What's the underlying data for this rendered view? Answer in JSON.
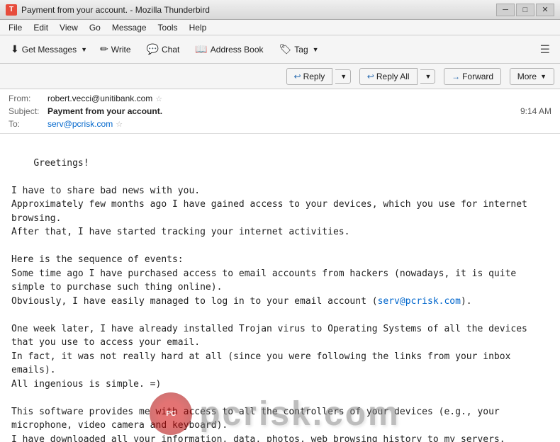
{
  "titlebar": {
    "icon_label": "T",
    "title": "Payment from your account. - Mozilla Thunderbird",
    "minimize_label": "─",
    "maximize_label": "□",
    "close_label": "✕"
  },
  "menubar": {
    "items": [
      {
        "label": "File"
      },
      {
        "label": "Edit"
      },
      {
        "label": "View"
      },
      {
        "label": "Go"
      },
      {
        "label": "Message"
      },
      {
        "label": "Tools"
      },
      {
        "label": "Help"
      }
    ]
  },
  "toolbar": {
    "get_messages_label": "Get Messages",
    "write_label": "Write",
    "chat_label": "Chat",
    "address_book_label": "Address Book",
    "tag_label": "Tag"
  },
  "action_bar": {
    "reply_label": "Reply",
    "reply_all_label": "Reply All",
    "forward_label": "Forward",
    "more_label": "More"
  },
  "email": {
    "from_label": "From:",
    "from_value": "robert.vecci@unitibank.com",
    "subject_label": "Subject:",
    "subject_value": "Payment from your account.",
    "to_label": "To:",
    "to_value": "serv@pcrisk.com",
    "time": "9:14 AM",
    "body": "Greetings!\n\nI have to share bad news with you.\nApproximately few months ago I have gained access to your devices, which you use for internet browsing.\nAfter that, I have started tracking your internet activities.\n\nHere is the sequence of events:\nSome time ago I have purchased access to email accounts from hackers (nowadays, it is quite simple to purchase such thing online).\nObviously, I have easily managed to log in to your email account (serv@pcrisk.com).\n\nOne week later, I have already installed Trojan virus to Operating Systems of all the devices that you use to access your email.\nIn fact, it was not really hard at all (since you were following the links from your inbox emails).\nAll ingenious is simple. =)\n\nThis software provides me with access to all the controllers of your devices (e.g., your microphone, video camera and keyboard).\nI have downloaded all your information, data, photos, web browsing history to my servers.\nI have access to all your messengers, social networks, emails, chat history and contacts list.\nMy virus continuously refreshes the signatures (it is driver-based), and hence remains invisible for antivirus software.\n\nLikewise, I guess by now you understand why I have stayed undetected until this letter...\n\nWhile gathering information about you, I have discovered that you are a big fan of adult websites.\nYou really love visiting porn websites and watching exciting videos, while enduring an enormous amount of pleasure.\nI have managed to record a number of your dirty scenes and montaged a few videos, which show the way you masturbate and reach orgasms."
  },
  "watermark": {
    "circle_text": "PC",
    "text": "pcrisk.com"
  }
}
